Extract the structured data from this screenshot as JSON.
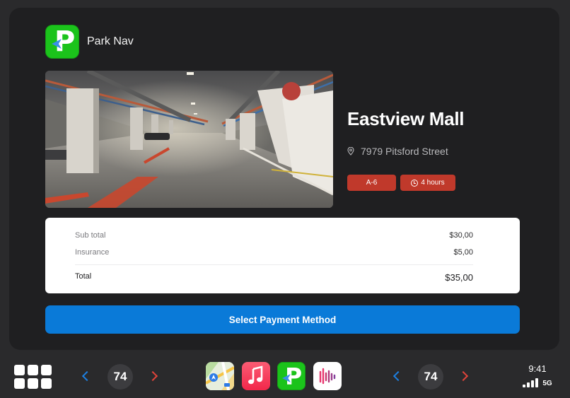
{
  "app": {
    "name": "Park Nav",
    "icon": "parking-p-icon"
  },
  "venue": {
    "title": "Eastview Mall",
    "address": "7979 Pitsford Street",
    "address_icon": "location-pin-icon",
    "spot_chip": "A-6",
    "duration_chip": "4 hours",
    "duration_icon": "clock-icon",
    "chip_color": "#c0392b"
  },
  "summary": {
    "subtotal_label": "Sub total",
    "subtotal_value": "$30,00",
    "insurance_label": "Insurance",
    "insurance_value": "$5,00",
    "total_label": "Total",
    "total_value": "$35,00"
  },
  "actions": {
    "pay_label": "Select Payment Method",
    "pay_color": "#0a7ad8"
  },
  "dock": {
    "left_temp": "74",
    "right_temp": "74",
    "apps": [
      "maps-icon",
      "music-icon",
      "park-nav-icon",
      "podcasts-icon"
    ],
    "clock": "9:41",
    "network": "5G",
    "signal_bars": 4
  }
}
